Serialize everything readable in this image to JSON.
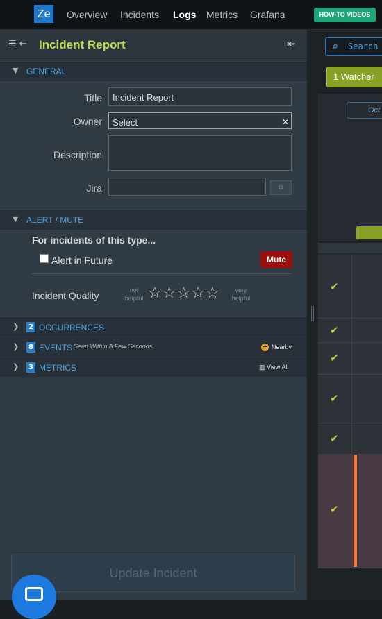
{
  "nav": {
    "logo": "Ze",
    "links": [
      "Overview",
      "Incidents",
      "Logs",
      "Metrics",
      "Grafana"
    ],
    "active": "Logs",
    "howto_label": "HOW-TO VIDEOS"
  },
  "panel": {
    "title": "Incident Report",
    "general": {
      "section_label": "GENERAL",
      "title_label": "Title",
      "title_value": "Incident Report",
      "owner_label": "Owner",
      "owner_value": "Select",
      "description_label": "Description",
      "description_value": "",
      "jira_label": "Jira",
      "jira_value": ""
    },
    "alert": {
      "section_label": "ALERT / MUTE",
      "heading": "For incidents of this type...",
      "checkbox_label": "Alert in Future",
      "mute_label": "Mute",
      "quality_label": "Incident Quality",
      "low_hint": "not helpful",
      "high_hint": "very helpful",
      "rating": 0,
      "max_rating": 5
    },
    "occurrences": {
      "count": "2",
      "label": "OCCURRENCES"
    },
    "events": {
      "count": "8",
      "label": "EVENTS",
      "note": "Seen Within A Few Seconds",
      "action": "Nearby"
    },
    "metrics": {
      "count": "3",
      "label": "METRICS",
      "action": "View All"
    },
    "update_label": "Update Incident"
  },
  "right": {
    "search_label": "Search",
    "watcher_label": "1 Watcher",
    "date_fragment": "Oct"
  },
  "colors": {
    "accent": "#c2d94e",
    "link_blue": "#4aa3df",
    "mute_red": "#9c0f0c",
    "green": "#8aa128",
    "howto_green": "#1fa47a"
  }
}
